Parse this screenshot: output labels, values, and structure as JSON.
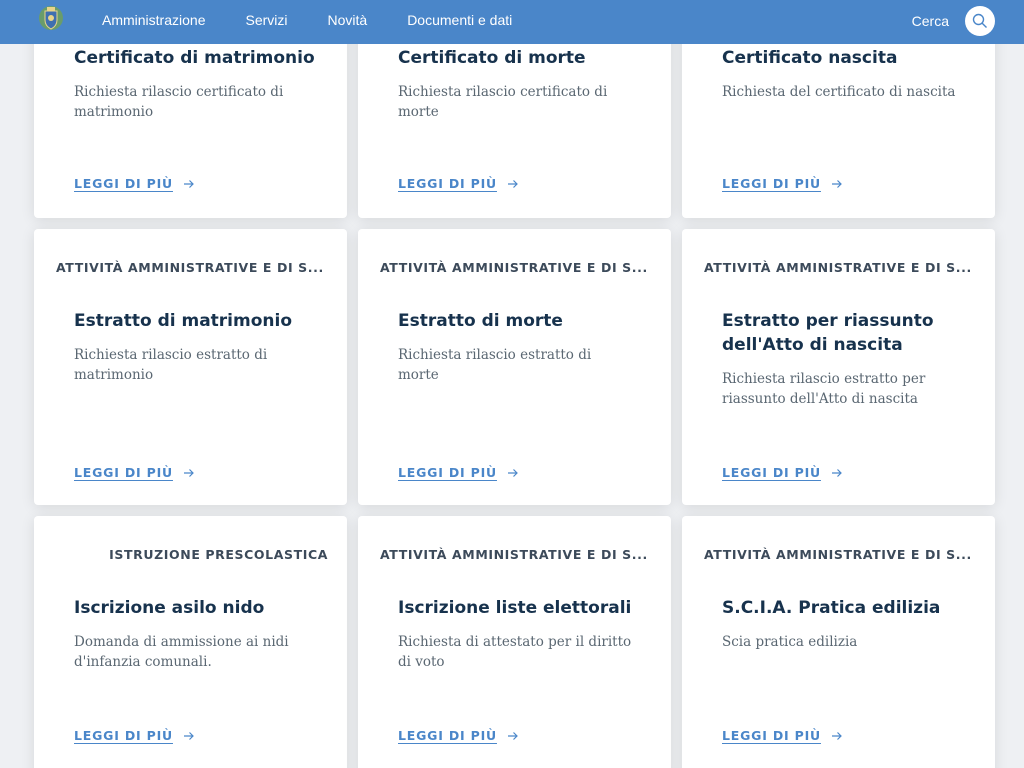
{
  "header": {
    "nav": [
      "Amministrazione",
      "Servizi",
      "Novità",
      "Documenti e dati"
    ],
    "search_label": "Cerca"
  },
  "link_label": "LEGGI DI PIÙ",
  "cards": [
    {
      "category": "",
      "title": "Certificato di matrimonio",
      "description": "Richiesta rilascio certificato di matrimonio"
    },
    {
      "category": "",
      "title": "Certificato di morte",
      "description": "Richiesta rilascio certificato di morte"
    },
    {
      "category": "",
      "title": "Certificato nascita",
      "description": "Richiesta del certificato di nascita"
    },
    {
      "category": "ATTIVITÀ AMMINISTRATIVE E DI S...",
      "title": "Estratto di matrimonio",
      "description": "Richiesta rilascio estratto di matrimonio"
    },
    {
      "category": "ATTIVITÀ AMMINISTRATIVE E DI S...",
      "title": "Estratto di morte",
      "description": "Richiesta rilascio estratto di morte"
    },
    {
      "category": "ATTIVITÀ AMMINISTRATIVE E DI S...",
      "title": "Estratto per riassunto dell'Atto di nascita",
      "description": "Richiesta rilascio estratto per riassunto dell'Atto di nascita"
    },
    {
      "category": "ISTRUZIONE PRESCOLASTICA",
      "title": "Iscrizione asilo nido",
      "description": "Domanda di ammissione ai nidi d'infanzia comunali."
    },
    {
      "category": "ATTIVITÀ AMMINISTRATIVE E DI S...",
      "title": "Iscrizione liste elettorali",
      "description": "Richiesta di attestato per il diritto di voto"
    },
    {
      "category": "ATTIVITÀ AMMINISTRATIVE E DI S...",
      "title": "S.C.I.A. Pratica edilizia",
      "description": "Scia pratica edilizia"
    }
  ],
  "colors": {
    "header_bg": "#4a86c9",
    "title": "#17324d",
    "link": "#4a86c9",
    "page_bg": "#eef0f3"
  },
  "icons": {
    "logo": "municipal-crest-icon",
    "search": "search-icon",
    "arrow": "arrow-right-icon"
  }
}
